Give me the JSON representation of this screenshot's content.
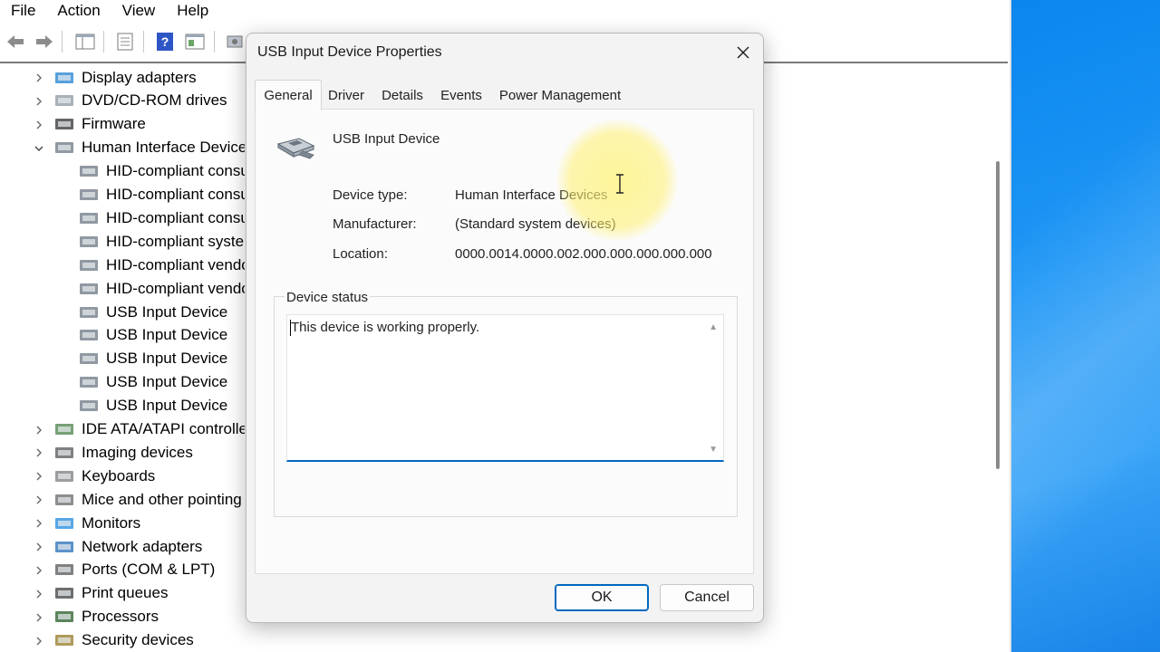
{
  "menubar": {
    "items": [
      "File",
      "Action",
      "View",
      "Help"
    ]
  },
  "toolbar": {
    "back_icon": "arrow-left-icon",
    "forward_icon": "arrow-right-icon",
    "colors": {
      "accent": "#0067c0"
    }
  },
  "tree": {
    "rows": [
      {
        "label": "Display adapters",
        "icon": "display-adapter-icon",
        "expanded": false,
        "level": 0
      },
      {
        "label": "DVD/CD-ROM drives",
        "icon": "dvd-drive-icon",
        "expanded": false,
        "level": 0
      },
      {
        "label": "Firmware",
        "icon": "firmware-icon",
        "expanded": false,
        "level": 0
      },
      {
        "label": "Human Interface Devices",
        "icon": "hid-icon",
        "expanded": true,
        "level": 0
      },
      {
        "label": "HID-compliant consumer control device",
        "icon": "hid-icon",
        "level": 1
      },
      {
        "label": "HID-compliant consumer control device",
        "icon": "hid-icon",
        "level": 1
      },
      {
        "label": "HID-compliant consumer control device",
        "icon": "hid-icon",
        "level": 1
      },
      {
        "label": "HID-compliant system controller",
        "icon": "hid-icon",
        "level": 1
      },
      {
        "label": "HID-compliant vendor-defined device",
        "icon": "hid-icon",
        "level": 1
      },
      {
        "label": "HID-compliant vendor-defined device",
        "icon": "hid-icon",
        "level": 1
      },
      {
        "label": "USB Input Device",
        "icon": "hid-icon",
        "level": 1
      },
      {
        "label": "USB Input Device",
        "icon": "hid-icon",
        "level": 1
      },
      {
        "label": "USB Input Device",
        "icon": "hid-icon",
        "level": 1
      },
      {
        "label": "USB Input Device",
        "icon": "hid-icon",
        "level": 1
      },
      {
        "label": "USB Input Device",
        "icon": "hid-icon",
        "level": 1
      },
      {
        "label": "IDE ATA/ATAPI controllers",
        "icon": "ide-controller-icon",
        "expanded": false,
        "level": 0
      },
      {
        "label": "Imaging devices",
        "icon": "camera-icon",
        "expanded": false,
        "level": 0
      },
      {
        "label": "Keyboards",
        "icon": "keyboard-icon",
        "expanded": false,
        "level": 0
      },
      {
        "label": "Mice and other pointing devices",
        "icon": "mouse-icon",
        "expanded": false,
        "level": 0
      },
      {
        "label": "Monitors",
        "icon": "monitor-icon",
        "expanded": false,
        "level": 0
      },
      {
        "label": "Network adapters",
        "icon": "network-adapter-icon",
        "expanded": false,
        "level": 0
      },
      {
        "label": "Ports (COM & LPT)",
        "icon": "port-icon",
        "expanded": false,
        "level": 0
      },
      {
        "label": "Print queues",
        "icon": "printer-icon",
        "expanded": false,
        "level": 0
      },
      {
        "label": "Processors",
        "icon": "processor-icon",
        "expanded": false,
        "level": 0
      },
      {
        "label": "Security devices",
        "icon": "security-device-icon",
        "expanded": false,
        "level": 0
      }
    ]
  },
  "dialog": {
    "title": "USB Input Device Properties",
    "tabs": [
      "General",
      "Driver",
      "Details",
      "Events",
      "Power Management"
    ],
    "active_tab": "General",
    "device_name": "USB Input Device",
    "properties": [
      {
        "label": "Device type:",
        "value": "Human Interface Devices"
      },
      {
        "label": "Manufacturer:",
        "value": "(Standard system devices)"
      },
      {
        "label": "Location:",
        "value": "0000.0014.0000.002.000.000.000.000.000"
      }
    ],
    "status_legend": "Device status",
    "status_text": "This device is working properly.",
    "ok_label": "OK",
    "cancel_label": "Cancel"
  }
}
